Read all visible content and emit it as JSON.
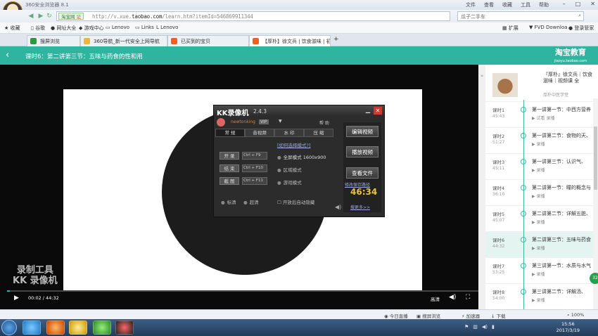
{
  "browser": {
    "title": "360安全浏览器 8.1",
    "menus": [
      "文件",
      "查看",
      "收藏",
      "工具",
      "帮助"
    ],
    "url_tag": "淘宝网",
    "url_tag_verified": "证",
    "url_prefix": "http://v.xue.",
    "url_host": "taobao.com",
    "url_rest": "/learn.htm?itemId=546869911344",
    "search_placeholder": "瓜子二手车",
    "bookmarks": [
      "收藏",
      "谷歌",
      "网址大全",
      "游戏中心",
      "Lenovo",
      "Links",
      "Lenovo"
    ],
    "bookmarks_right": [
      "扩展",
      "FVD Downloa",
      "登录管家"
    ],
    "tabs": [
      "搜屏浏览",
      "360导航_新一代安全上网导航",
      "已买到的宝贝",
      "【厚朴】徐文兵 | 饮食滋味 | 初",
      "+"
    ]
  },
  "page": {
    "back": "‹",
    "header_title": "课时6：第二讲第三节：五味与药食的性和用",
    "brand": "淘宝教育",
    "brand_sub": "jiaoyu.taobao.com"
  },
  "kk": {
    "name": "KK录像机",
    "version": "2.4.3",
    "user": "newtonking",
    "vip": "VIP",
    "help": "帮 助",
    "tabs": [
      "常 规",
      "音视频",
      "水 印",
      "压 缩"
    ],
    "how": "[如何选择模式?]",
    "buttons": [
      {
        "label": "开 录",
        "key": "Ctrl + F9"
      },
      {
        "label": "结 束",
        "key": "Ctrl + F10"
      },
      {
        "label": "截 图",
        "key": "Ctrl + F11"
      }
    ],
    "modes": [
      "全屏模式  1600x900",
      "区域模式",
      "游戏模式"
    ],
    "quality": [
      "标清",
      "超清"
    ],
    "autostart": "开放后自动隐藏",
    "right_buttons": [
      "编辑视频",
      "播放视频",
      "查看文件"
    ],
    "change_path": "修改保存路径",
    "time": "46:34",
    "more": "搜更多>>"
  },
  "player": {
    "watermark1": "录制工具",
    "watermark2": "KK 录像机",
    "time": "00:02 / 44:32",
    "quality": "高清",
    "progress": 0.001
  },
  "course": {
    "title": "『厚朴』徐文兵｜饮食滋味｜视频课 全",
    "school": "厚朴中医学堂"
  },
  "lessons": [
    {
      "no": "课时1",
      "dur": "45:43",
      "title": "第一讲第一节：中西方营养",
      "tag": "试看  录播"
    },
    {
      "no": "课时2",
      "dur": "51:27",
      "title": "第一讲第二节：食物的天、",
      "tag": "录播"
    },
    {
      "no": "课时3",
      "dur": "45:11",
      "title": "第一讲第三节：认识气、",
      "tag": "录播"
    },
    {
      "no": "课时4",
      "dur": "36:10",
      "title": "第二讲第一节：瞳的概念与",
      "tag": "录播"
    },
    {
      "no": "课时5",
      "dur": "45:07",
      "title": "第二讲第二节：详解五脏、",
      "tag": "录播"
    },
    {
      "no": "课时6",
      "dur": "44:32",
      "title": "第二讲第三节：五味与药食",
      "tag": "录播"
    },
    {
      "no": "课时7",
      "dur": "53:25",
      "title": "第三讲第一节：水质与水气",
      "tag": "录播"
    },
    {
      "no": "课时8",
      "dur": "54:00",
      "title": "第三讲第二节：详解汤、",
      "tag": "录播"
    }
  ],
  "status": [
    "今日直播",
    "搜屏浏览",
    "加速器",
    "下载",
    "100%"
  ],
  "clock": {
    "time": "15:56",
    "date": "2017/3/19"
  },
  "float_label": "32"
}
